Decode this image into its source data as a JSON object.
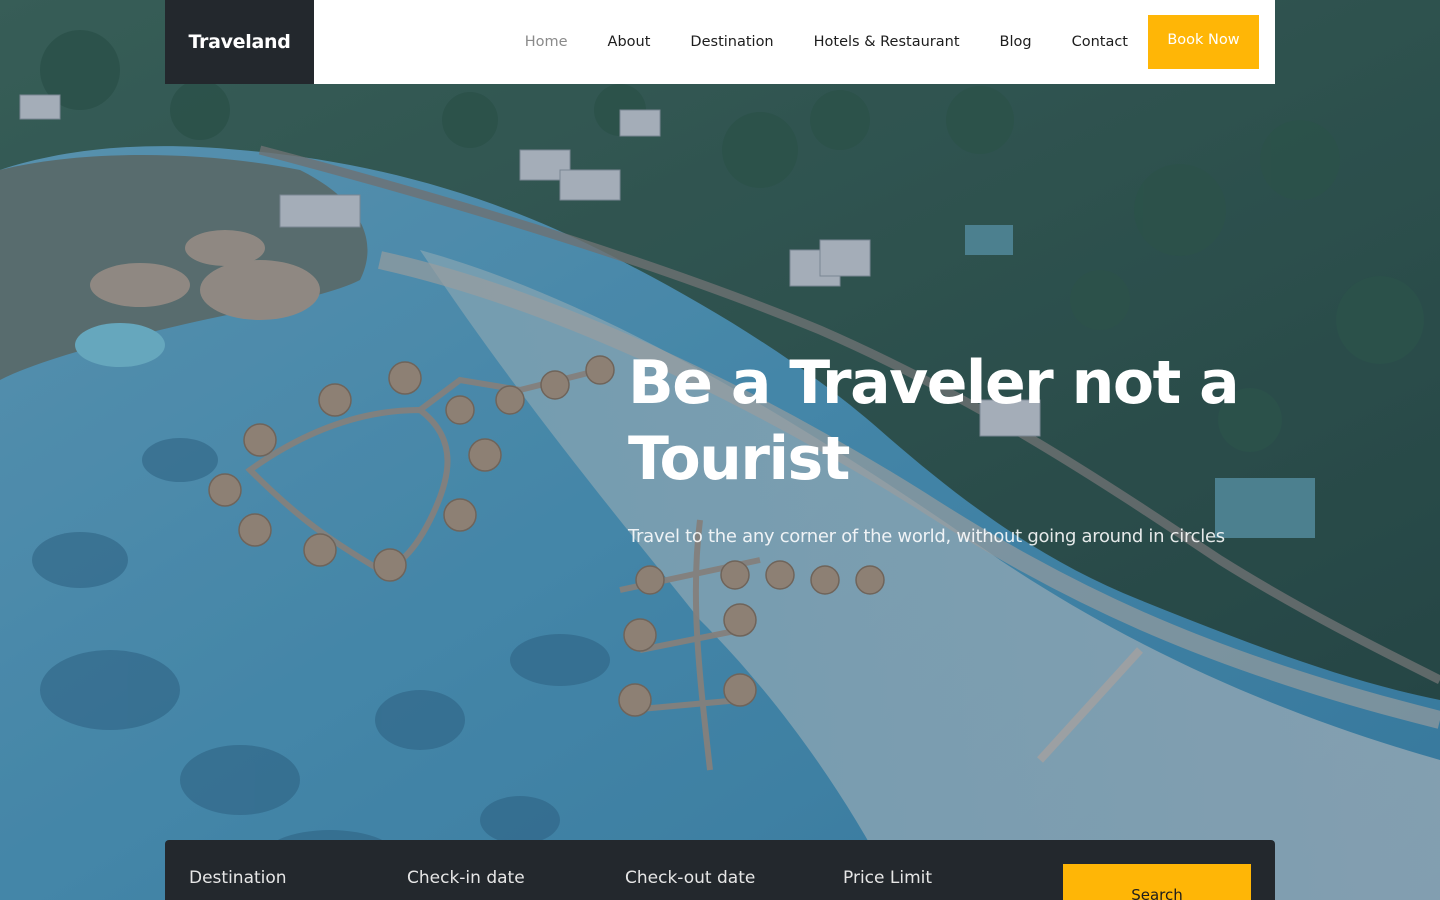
{
  "brand": {
    "logo_text": "Traveland"
  },
  "nav": {
    "items": [
      {
        "label": "Home",
        "active": true
      },
      {
        "label": "About",
        "active": false
      },
      {
        "label": "Destination",
        "active": false
      },
      {
        "label": "Hotels & Restaurant",
        "active": false
      },
      {
        "label": "Blog",
        "active": false
      },
      {
        "label": "Contact",
        "active": false
      }
    ],
    "cta_label": "Book Now"
  },
  "hero": {
    "title": "Be a Traveler not a Tourist",
    "subtitle": "Travel to the any corner of the world, without going around in circles"
  },
  "search": {
    "fields": [
      {
        "label": "Destination"
      },
      {
        "label": "Check-in date"
      },
      {
        "label": "Check-out date"
      },
      {
        "label": "Price Limit"
      }
    ],
    "button_label": "Search"
  },
  "colors": {
    "accent": "#ffb606",
    "dark": "#23282d",
    "nav_bg": "#ffffff",
    "water": "#5aa9c4",
    "forest": "#2f5a44"
  }
}
